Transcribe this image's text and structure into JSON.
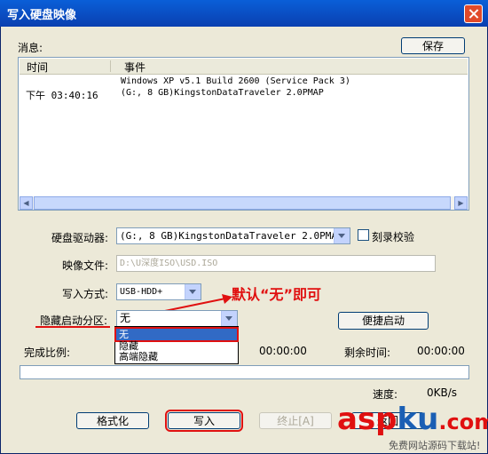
{
  "window": {
    "title": "写入硬盘映像"
  },
  "messages": {
    "label": "消息:",
    "save_label": "保存",
    "columns": [
      "时间",
      "事件"
    ],
    "rows": [
      {
        "time": "下午 03:40:16",
        "event_line1": "Windows XP v5.1 Build 2600 (Service Pack 3)",
        "event_line2": "(G:, 8 GB)KingstonDataTraveler 2.0PMAP"
      }
    ]
  },
  "drive": {
    "label": "硬盘驱动器:",
    "value": "(G:, 8 GB)KingstonDataTraveler 2.0PMAP"
  },
  "verify": {
    "label": "刻录校验",
    "checked": false
  },
  "image_file": {
    "label": "映像文件:",
    "value": "D:\\U深度ISO\\USD.ISO"
  },
  "write_mode": {
    "label": "写入方式:",
    "value": "USB-HDD+"
  },
  "hidden_partition": {
    "label": "隐藏启动分区:",
    "value": "无",
    "options": [
      "无",
      "隐藏",
      "高端隐藏"
    ]
  },
  "quick_boot": {
    "label": "便捷启动"
  },
  "annotation": {
    "text": "默认“无”即可"
  },
  "progress": {
    "completion_label": "完成比例:",
    "elapsed": "00:00:00",
    "remaining_label": "剩余时间:",
    "remaining": "00:00:00",
    "percent": 0
  },
  "speed": {
    "label": "速度:",
    "value": "0KB/s"
  },
  "buttons": {
    "format": "格式化",
    "write": "写入",
    "stop": "终止[A]",
    "back": "返回"
  },
  "watermark": {
    "brand_asp": "asp",
    "brand_ku": "ku",
    "brand_com": ".com",
    "tagline": "免费网站源码下载站!"
  },
  "colors": {
    "accent": "#316ac5",
    "annotation": "#e01010",
    "watermark_red": "#e01010",
    "watermark_blue": "#1a5fb4"
  }
}
